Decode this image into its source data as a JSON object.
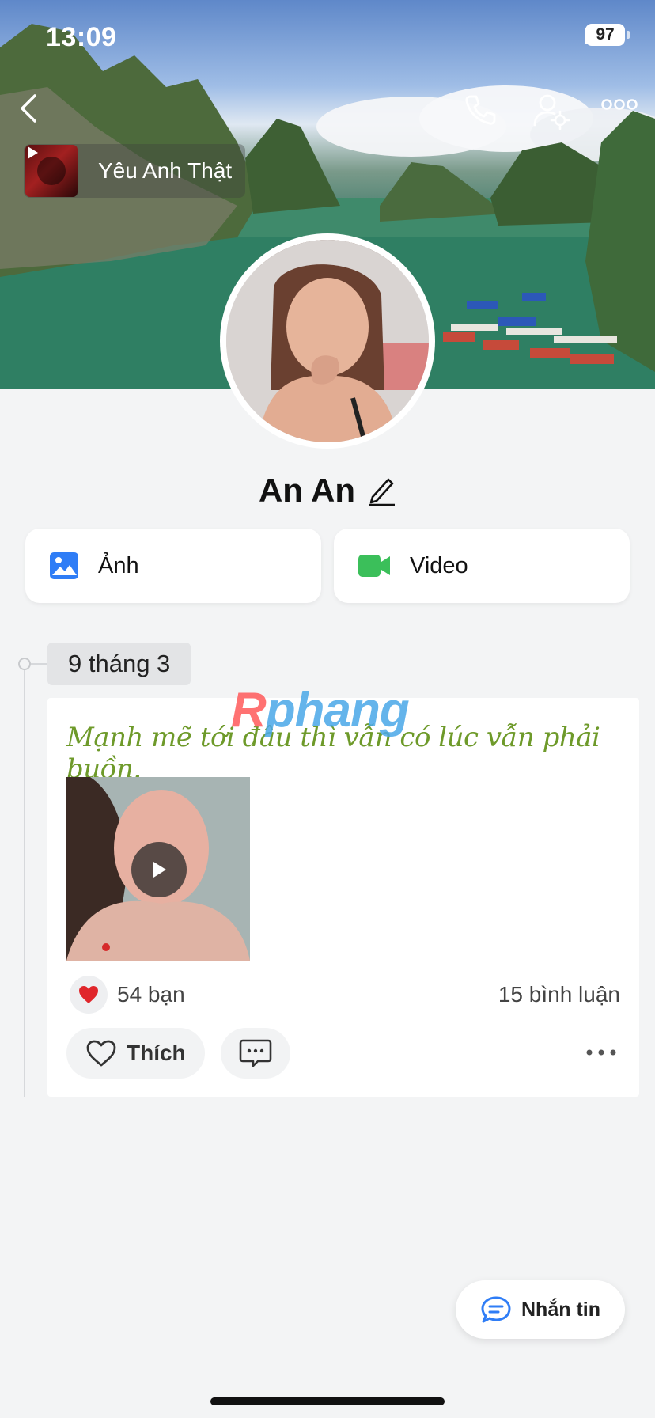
{
  "status_bar": {
    "time": "13:09",
    "battery": "97"
  },
  "music": {
    "title": "Yêu Anh Thật"
  },
  "profile": {
    "name": "An An"
  },
  "media": {
    "photo_label": "Ảnh",
    "video_label": "Video"
  },
  "timeline": {
    "date": "9 tháng 3"
  },
  "post": {
    "text": "Mạnh mẽ tới đâu thì vẫn có lúc vẫn phải buồn.",
    "likes": "54 bạn",
    "comments": "15 bình luận",
    "like_label": "Thích"
  },
  "watermark": {
    "part1": "R",
    "part2": "phang"
  },
  "message_button": {
    "label": "Nhắn tin"
  },
  "colors": {
    "accent_blue": "#2f7df6",
    "video_green": "#3bbf5a",
    "post_text_green": "#6e9a2a",
    "heart_red": "#e0262b"
  },
  "icons": [
    "back-icon",
    "phone-icon",
    "user-settings-icon",
    "more-icon",
    "play-icon",
    "edit-pencil-icon",
    "photo-icon",
    "video-camera-icon",
    "heart-icon",
    "comment-icon",
    "chat-icon"
  ]
}
